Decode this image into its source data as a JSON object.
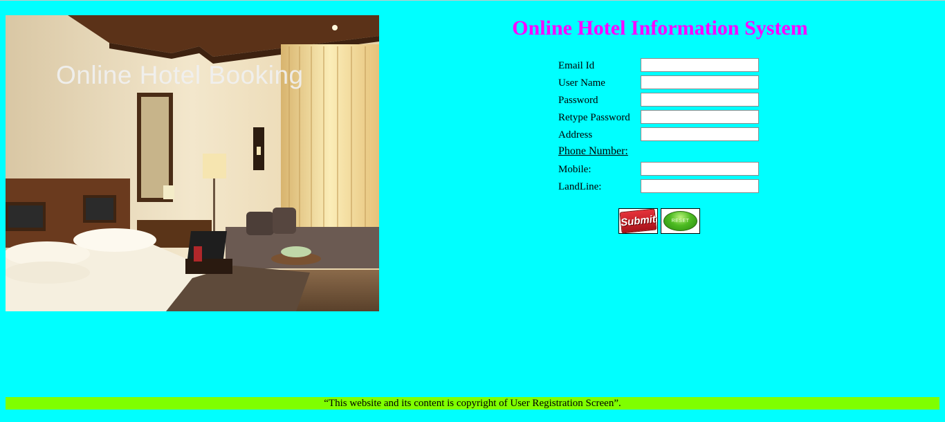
{
  "hero": {
    "caption": "Online Hotel Booking"
  },
  "title": "Online Hotel Information System",
  "form": {
    "fields": [
      {
        "label": "Email Id",
        "value": ""
      },
      {
        "label": "User Name",
        "value": ""
      },
      {
        "label": "Password",
        "value": ""
      },
      {
        "label": "Retype Password",
        "value": ""
      },
      {
        "label": "Address",
        "value": ""
      }
    ],
    "phone_section_label": "Phone Number:",
    "phone_fields": [
      {
        "label": "Mobile:",
        "value": ""
      },
      {
        "label": "LandLine:",
        "value": ""
      }
    ],
    "submit_label": "Submit",
    "reset_label": "RESET"
  },
  "footer": {
    "text": "“This website and its content is copyright of User Registration Screen”."
  },
  "colors": {
    "background": "#00ffff",
    "title": "#ff00ff",
    "footer_bar": "#7fff00"
  }
}
